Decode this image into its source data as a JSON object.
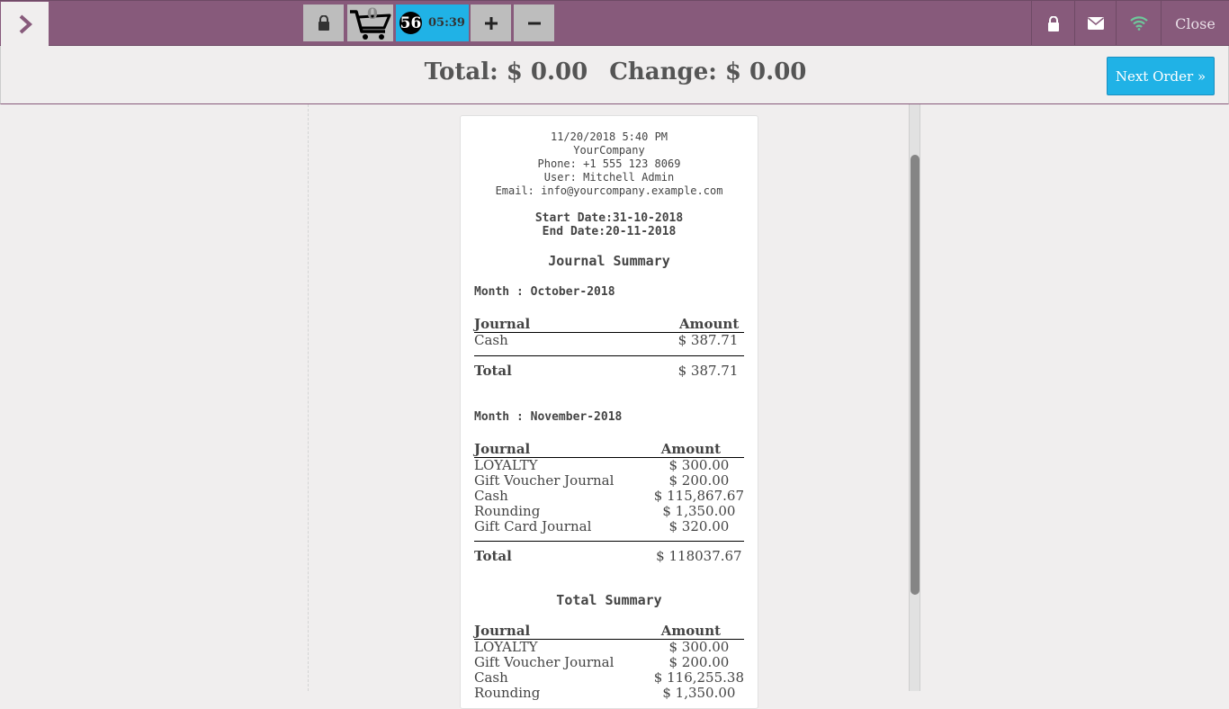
{
  "toolbar": {
    "cart_count": "0",
    "order_count": "56",
    "timer": "05:39",
    "close_label": "Close"
  },
  "header": {
    "total_label": "Total: $ 0.00",
    "change_label": "Change: $ 0.00",
    "next_order_label": "Next Order »"
  },
  "receipt": {
    "datetime": "11/20/2018 5:40 PM",
    "company": "YourCompany",
    "phone": "Phone: +1 555 123 8069",
    "user": "User: Mitchell Admin",
    "email": "Email: info@yourcompany.example.com",
    "start_date": "Start Date:31-10-2018",
    "end_date": "End Date:20-11-2018",
    "journal_summary_title": "Journal Summary",
    "col_journal": "Journal",
    "col_amount": "Amount",
    "total_label": "Total",
    "months": [
      {
        "title": "Month : October-2018",
        "rows": [
          {
            "journal": "Cash",
            "amount": "$ 387.71"
          }
        ],
        "total": "$ 387.71"
      },
      {
        "title": "Month : November-2018",
        "rows": [
          {
            "journal": "LOYALTY",
            "amount": "$ 300.00"
          },
          {
            "journal": "Gift Voucher Journal",
            "amount": "$ 200.00"
          },
          {
            "journal": "Cash",
            "amount": "$ 115,867.67"
          },
          {
            "journal": "Rounding",
            "amount": "$ 1,350.00"
          },
          {
            "journal": "Gift Card Journal",
            "amount": "$ 320.00"
          }
        ],
        "total": "$ 118037.67"
      }
    ],
    "total_summary_title": "Total Summary",
    "total_summary_rows": [
      {
        "journal": "LOYALTY",
        "amount": "$ 300.00"
      },
      {
        "journal": "Gift Voucher Journal",
        "amount": "$ 200.00"
      },
      {
        "journal": "Cash",
        "amount": "$ 116,255.38"
      },
      {
        "journal": "Rounding",
        "amount": "$ 1,350.00"
      }
    ]
  },
  "colors": {
    "topbar": "#875a7b",
    "accent": "#20b2e6",
    "wifi": "#6ec89b"
  }
}
